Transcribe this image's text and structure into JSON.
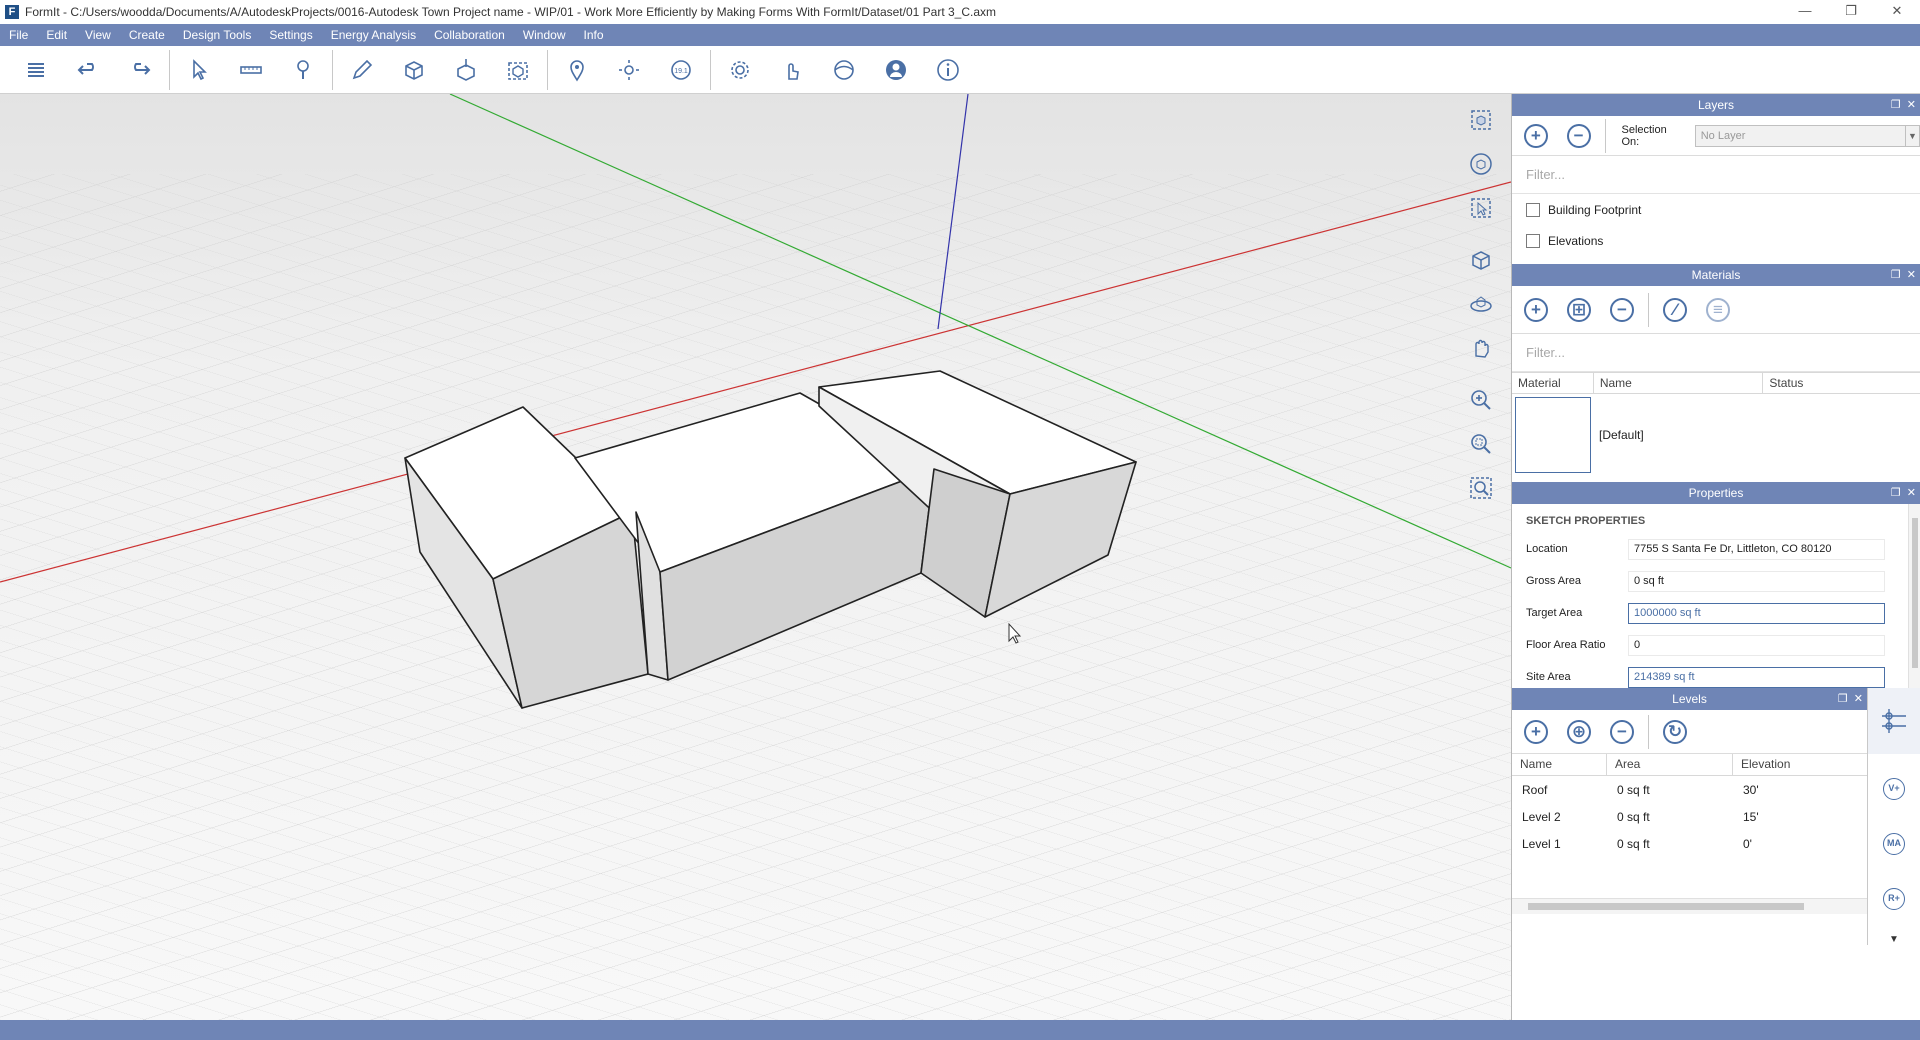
{
  "window": {
    "title": "FormIt - C:/Users/woodda/Documents/A/AutodeskProjects/0016-Autodesk Town Project name - WIP/01 - Work More Efficiently by Making Forms With FormIt/Dataset/01 Part 3_C.axm",
    "logo_letter": "F",
    "minimize": "—",
    "restore": "❐",
    "close": "✕"
  },
  "menu": [
    "File",
    "Edit",
    "View",
    "Create",
    "Design Tools",
    "Settings",
    "Energy Analysis",
    "Collaboration",
    "Window",
    "Info"
  ],
  "toolbar": {
    "icons": [
      "menu-icon",
      "undo-icon",
      "redo-icon",
      "select-icon",
      "tape-measure-icon",
      "paint-icon",
      "draw-icon",
      "solid-box-icon",
      "solid-extrude-icon",
      "group-icon",
      "location-icon",
      "sun-icon",
      "scale-icon",
      "settings-icon",
      "touch-icon",
      "sphere-icon",
      "account-icon",
      "info-icon"
    ]
  },
  "layers": {
    "title": "Layers",
    "selection_on_label": "Selection On:",
    "selection_value": "No Layer",
    "filter_placeholder": "Filter...",
    "items": [
      {
        "label": "Building Footprint",
        "checked": false
      },
      {
        "label": "Elevations",
        "checked": false
      }
    ]
  },
  "materials": {
    "title": "Materials",
    "filter_placeholder": "Filter...",
    "columns": [
      "Material",
      "Name",
      "Status"
    ],
    "rows": [
      {
        "name": "[Default]"
      }
    ]
  },
  "properties": {
    "title": "Properties",
    "section": "SKETCH PROPERTIES",
    "rows": [
      {
        "label": "Location",
        "value": "7755 S Santa Fe Dr, Littleton, CO 80120",
        "editable": false
      },
      {
        "label": "Gross Area",
        "value": "0 sq ft",
        "editable": false
      },
      {
        "label": "Target Area",
        "value": "1000000 sq ft",
        "editable": true
      },
      {
        "label": "Floor Area Ratio",
        "value": "0",
        "editable": false
      },
      {
        "label": "Site Area",
        "value": "214389 sq ft",
        "editable": true
      }
    ]
  },
  "levels": {
    "title": "Levels",
    "columns": [
      "Name",
      "Area",
      "Elevation"
    ],
    "rows": [
      {
        "name": "Roof",
        "area": "0 sq ft",
        "elevation": "30'"
      },
      {
        "name": "Level 2",
        "area": "0 sq ft",
        "elevation": "15'"
      },
      {
        "name": "Level 1",
        "area": "0 sq ft",
        "elevation": "0'"
      }
    ]
  },
  "side_tabs": [
    "V+",
    "MA",
    "R+"
  ],
  "colors": {
    "accent": "#6f85b6",
    "icon_blue": "#4a6fa5",
    "axis_red": "#cc3333",
    "axis_green": "#33aa33",
    "axis_blue": "#3333aa"
  }
}
